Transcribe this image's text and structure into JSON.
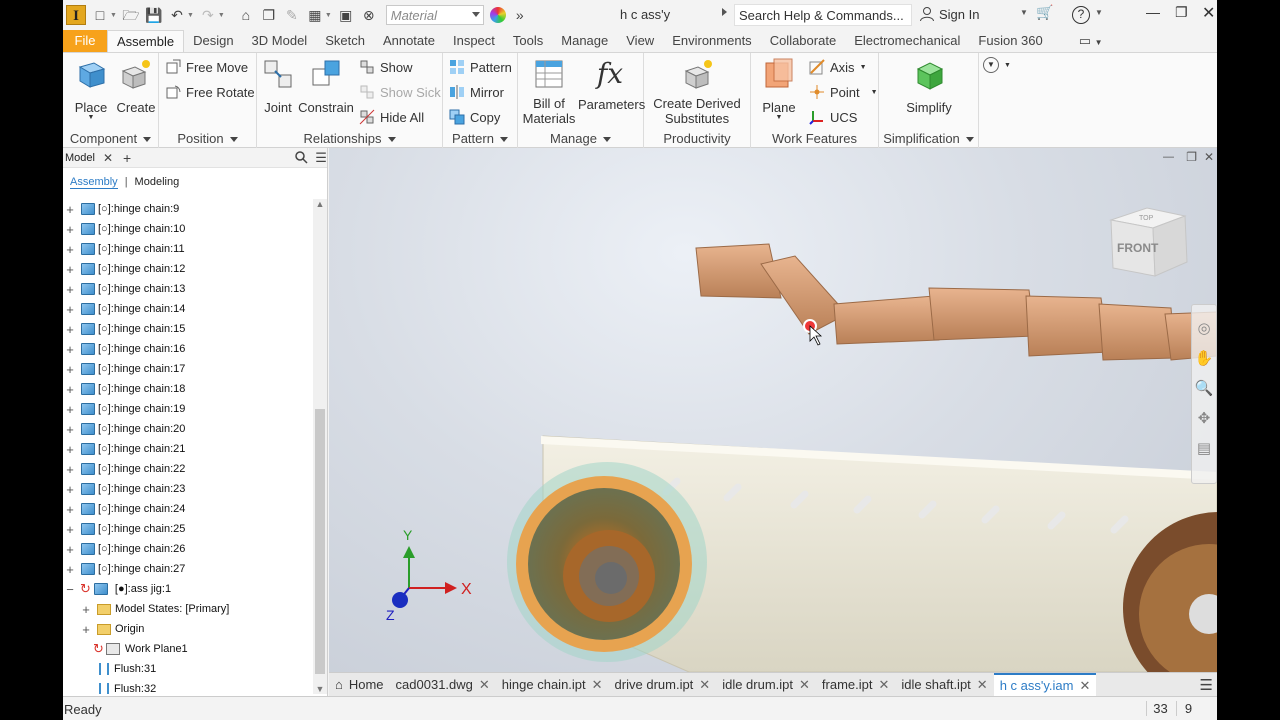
{
  "app": {
    "logo_letter": "I",
    "material_placeholder": "Material",
    "document_title": "h c ass'y",
    "search_placeholder": "Search Help & Commands...",
    "sign_in": "Sign In"
  },
  "tabs": [
    "File",
    "Assemble",
    "Design",
    "3D Model",
    "Sketch",
    "Annotate",
    "Inspect",
    "Tools",
    "Manage",
    "View",
    "Environments",
    "Collaborate",
    "Electromechanical",
    "Fusion 360"
  ],
  "ribbon": {
    "component": {
      "label": "Component",
      "place": "Place",
      "create": "Create"
    },
    "position": {
      "label": "Position",
      "free_move": "Free Move",
      "free_rotate": "Free Rotate"
    },
    "relationships": {
      "label": "Relationships",
      "joint": "Joint",
      "constrain": "Constrain",
      "show": "Show",
      "show_sick": "Show Sick",
      "hide_all": "Hide All"
    },
    "pattern": {
      "label": "Pattern",
      "pattern": "Pattern",
      "mirror": "Mirror",
      "copy": "Copy"
    },
    "manage": {
      "label": "Manage",
      "bom_line1": "Bill of",
      "bom_line2": "Materials",
      "parameters": "Parameters"
    },
    "productivity": {
      "label": "Productivity",
      "derived_line1": "Create Derived",
      "derived_line2": "Substitutes"
    },
    "work_features": {
      "label": "Work Features",
      "plane": "Plane",
      "axis": "Axis",
      "point": "Point",
      "ucs": "UCS"
    },
    "simplification": {
      "label": "Simplification",
      "simplify": "Simplify"
    }
  },
  "browser": {
    "title": "Model",
    "tab_assembly": "Assembly",
    "tab_modeling": "Modeling",
    "items": [
      "[○]:hinge chain:9",
      "[○]:hinge chain:10",
      "[○]:hinge chain:11",
      "[○]:hinge chain:12",
      "[○]:hinge chain:13",
      "[○]:hinge chain:14",
      "[○]:hinge chain:15",
      "[○]:hinge chain:16",
      "[○]:hinge chain:17",
      "[○]:hinge chain:18",
      "[○]:hinge chain:19",
      "[○]:hinge chain:20",
      "[○]:hinge chain:21",
      "[○]:hinge chain:22",
      "[○]:hinge chain:23",
      "[○]:hinge chain:24",
      "[○]:hinge chain:25",
      "[○]:hinge chain:26",
      "[○]:hinge chain:27"
    ],
    "ass_jig": "[●]:ass jig:1",
    "model_states": "Model States: [Primary]",
    "origin": "Origin",
    "work_plane": "Work Plane1",
    "flush1": "Flush:31",
    "flush2": "Flush:32"
  },
  "viewcube": {
    "top": "TOP",
    "front": "FRONT"
  },
  "triad": {
    "x": "X",
    "y": "Y",
    "z": "Z"
  },
  "doc_tabs": [
    "Home",
    "cad0031.dwg",
    "hinge chain.ipt",
    "drive drum.ipt",
    "idle drum.ipt",
    "frame.ipt",
    "idle shaft.ipt",
    "h c ass'y.iam"
  ],
  "status": {
    "text": "Ready",
    "num1": "33",
    "num2": "9"
  }
}
